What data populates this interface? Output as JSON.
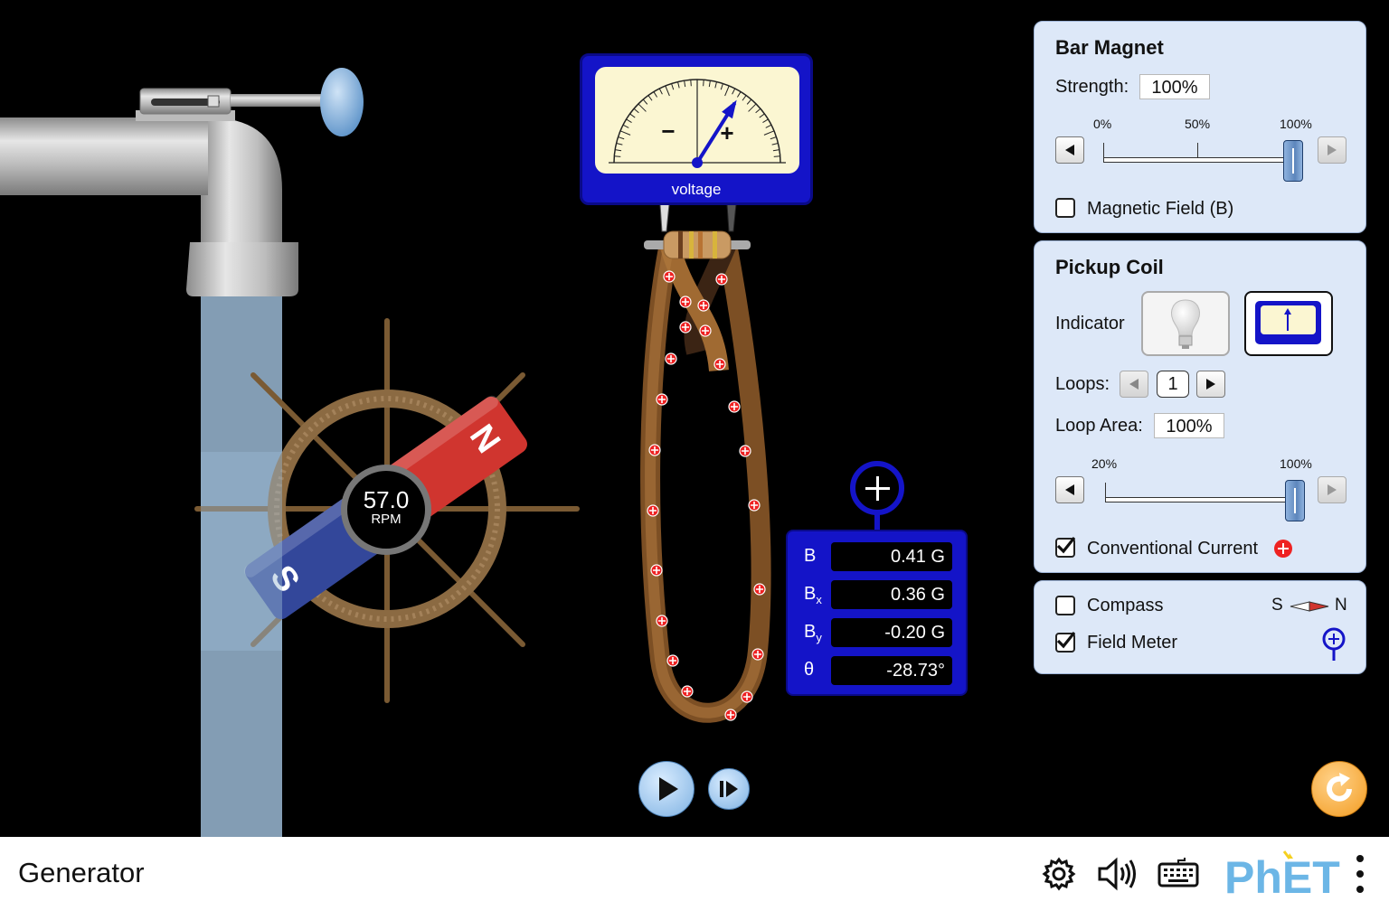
{
  "meter": {
    "label": "voltage",
    "minus": "−",
    "plus": "+",
    "needle_fraction": 0.65
  },
  "wheel": {
    "rpm_value": "57.0",
    "rpm_unit": "RPM"
  },
  "magnet": {
    "north": "N",
    "south": "S"
  },
  "field_meter": {
    "rows": [
      {
        "label": "B",
        "sub": "",
        "value": "0.41 G"
      },
      {
        "label": "B",
        "sub": "x",
        "value": "0.36 G"
      },
      {
        "label": "B",
        "sub": "y",
        "value": "-0.20 G"
      },
      {
        "label": "θ",
        "sub": "",
        "value": "-28.73°"
      }
    ]
  },
  "bar_magnet_panel": {
    "title": "Bar Magnet",
    "strength_label": "Strength:",
    "strength_value": "100%",
    "ticks": [
      "0%",
      "50%",
      "100%"
    ],
    "strength_fraction": 1.0,
    "magnetic_field_label": "Magnetic Field (B)",
    "magnetic_field_checked": false
  },
  "pickup_coil_panel": {
    "title": "Pickup Coil",
    "indicator_label": "Indicator",
    "selected_indicator": "voltmeter",
    "loops_label": "Loops:",
    "loops_value": "1",
    "loop_area_label": "Loop Area:",
    "loop_area_value": "100%",
    "ticks": [
      "20%",
      "100%"
    ],
    "loop_area_fraction": 1.0,
    "conventional_current_label": "Conventional Current",
    "conventional_current_checked": true
  },
  "options_panel": {
    "compass_label": "Compass",
    "compass_checked": false,
    "compass_s": "S",
    "compass_n": "N",
    "field_meter_label": "Field Meter",
    "field_meter_checked": true
  },
  "footer": {
    "title": "Generator",
    "logo_text": "PhET"
  },
  "colors": {
    "panel_bg": "#dde8f8",
    "meter_blue": "#1414c8",
    "magnet_north": "#d0352f",
    "magnet_south": "#33479a",
    "reset_orange": "#f39c21"
  }
}
